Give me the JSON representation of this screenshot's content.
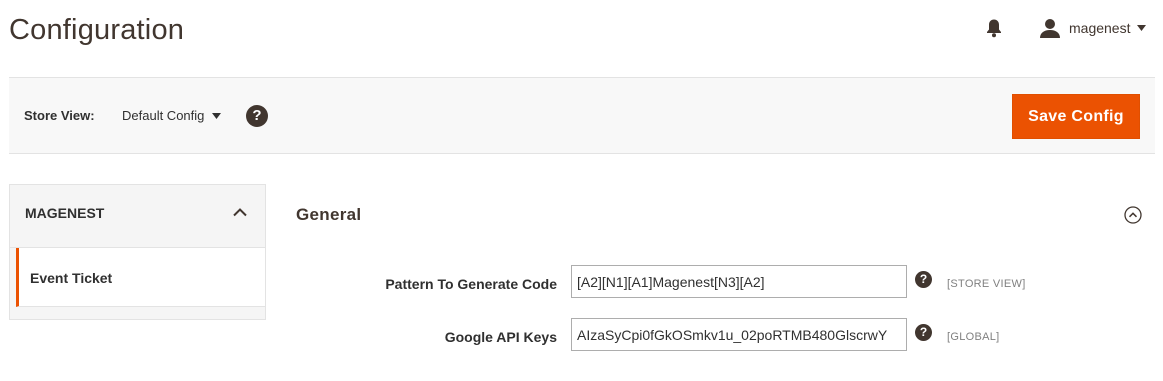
{
  "header": {
    "title": "Configuration",
    "username": "magenest"
  },
  "toolbar": {
    "store_view_label": "Store View:",
    "store_view_value": "Default Config",
    "help_glyph": "?",
    "save_label": "Save Config"
  },
  "sidebar": {
    "group_label": "MAGENEST",
    "items": [
      {
        "label": "Event Ticket",
        "active": true
      }
    ]
  },
  "section": {
    "title": "General",
    "fields": [
      {
        "label": "Pattern To Generate Code",
        "value": "[A2][N1][A1]Magenest[N3][A2]",
        "scope": "[STORE VIEW]",
        "help": "?"
      },
      {
        "label": "Google API Keys",
        "value": "AIzaSyCpi0fGkOSmkv1u_02poRTMB480GlscrwY",
        "scope": "[GLOBAL]",
        "help": "?"
      }
    ]
  },
  "colors": {
    "accent": "#eb5202",
    "dark": "#41362f",
    "toolbar_bg": "#f8f8f8"
  },
  "icons": [
    "bell-icon",
    "user-icon",
    "caret-down-icon",
    "help-icon",
    "chevron-up-icon",
    "collapse-circle-icon"
  ]
}
